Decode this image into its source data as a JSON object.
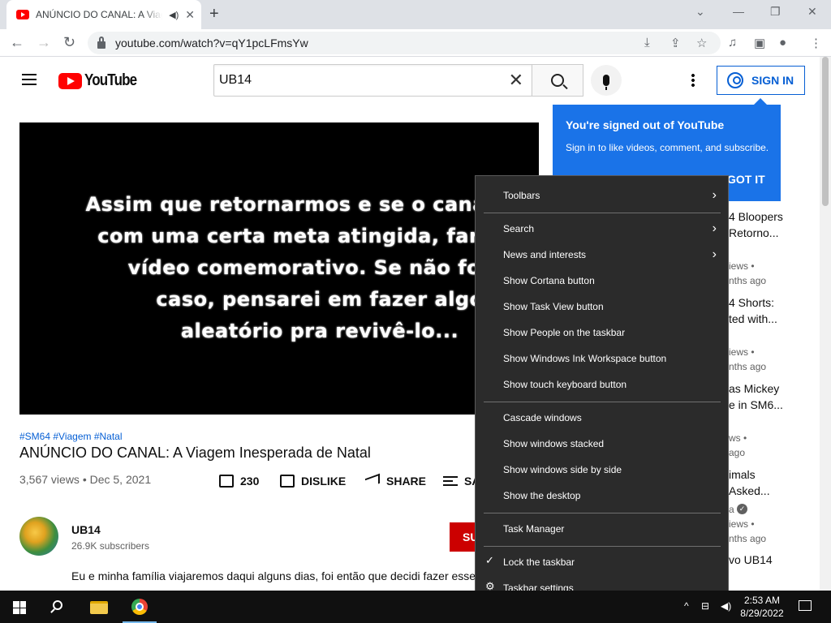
{
  "browser": {
    "tab_title": "ANÚNCIO DO CANAL: A Viagem Inesperada de Natal",
    "url": "youtube.com/watch?v=qY1pcLFmsYw"
  },
  "youtube": {
    "logo_text": "YouTube",
    "search_value": "UB14",
    "sign_in_label": "SIGN IN",
    "tooltip": {
      "heading": "You're signed out of YouTube",
      "body": "Sign in to like videos, comment, and subscribe.",
      "button": "GOT IT"
    },
    "video": {
      "caption": "Assim que retornarmos e se o canal tiver\ncom uma certa meta atingida, farei um\nvídeo comemorativo. Se não for o\ncaso, pensarei em fazer algo\naleatório pra revivê-lo...",
      "hashtags": "#SM64 #Viagem #Natal",
      "title": "ANÚNCIO DO CANAL: A Viagem Inesperada de Natal",
      "meta": "3,567 views • Dec 5, 2021",
      "like_count": "230",
      "dislike_label": "DISLIKE",
      "share_label": "SHARE",
      "save_label": "SA"
    },
    "channel": {
      "name": "UB14",
      "subscribers": "26.9K subscribers",
      "subscribe_label": "SU"
    },
    "description": "Eu e minha família viajaremos daqui alguns dias, foi então que decidi fazer esse",
    "related": [
      {
        "title": "4 Bloopers\nRetorno...",
        "meta": "iews •\nnths ago"
      },
      {
        "title": "4 Shorts:\nted with...",
        "meta": "iews •\nnths ago"
      },
      {
        "title": "as Mickey\ne in SM6...",
        "meta": "ws •\nago"
      },
      {
        "title": "imals\nAsked...",
        "meta": "a\niews •\nnths ago"
      },
      {
        "title": "vo UB14",
        "meta": ""
      }
    ]
  },
  "context_menu": {
    "items": [
      {
        "label": "Toolbars",
        "submenu": true
      },
      {
        "label": "Search",
        "submenu": true
      },
      {
        "label": "News and interests",
        "submenu": true
      },
      {
        "label": "Show Cortana button"
      },
      {
        "label": "Show Task View button"
      },
      {
        "label": "Show People on the taskbar"
      },
      {
        "label": "Show Windows Ink Workspace button"
      },
      {
        "label": "Show touch keyboard button"
      },
      {
        "label": "Cascade windows"
      },
      {
        "label": "Show windows stacked"
      },
      {
        "label": "Show windows side by side"
      },
      {
        "label": "Show the desktop"
      },
      {
        "label": "Task Manager"
      },
      {
        "label": "Lock the taskbar",
        "checked": true
      },
      {
        "label": "Taskbar settings",
        "icon": "gear-icon"
      }
    ]
  },
  "taskbar": {
    "time": "2:53 AM",
    "date": "8/29/2022"
  },
  "colors": {
    "youtube_red": "#ff0000",
    "link_blue": "#065fd4",
    "tooltip_blue": "#1a73e8",
    "menu_bg": "#2b2b2b",
    "taskbar_bg": "#101010"
  }
}
